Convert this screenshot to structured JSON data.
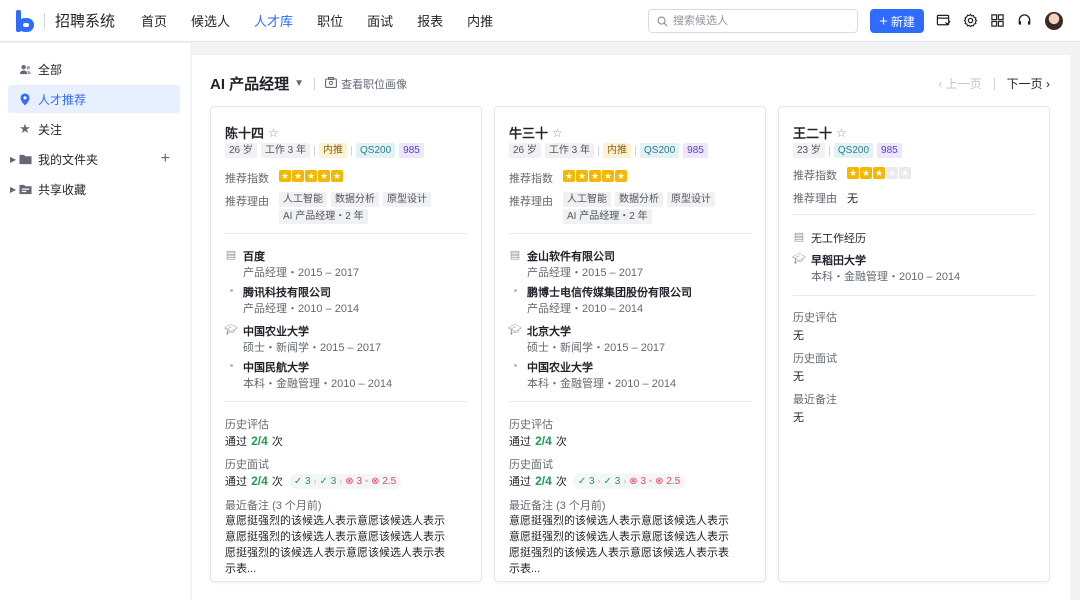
{
  "app": {
    "title": "招聘系统"
  },
  "nav": [
    "首页",
    "候选人",
    "人才库",
    "职位",
    "面试",
    "报表",
    "内推"
  ],
  "nav_active": "人才库",
  "search": {
    "placeholder": "搜索候选人"
  },
  "new_button": "新建",
  "top_icons": [
    "task-icon",
    "gear-icon",
    "apps-grid-icon",
    "headset-icon"
  ],
  "sidebar": {
    "items": [
      {
        "label": "全部",
        "icon": "users-icon"
      },
      {
        "label": "人才推荐",
        "icon": "location-pin-icon"
      },
      {
        "label": "关注",
        "icon": "star-icon"
      },
      {
        "label": "我的文件夹",
        "icon": "folder-icon"
      },
      {
        "label": "共享收藏",
        "icon": "shared-folder-icon"
      }
    ]
  },
  "main": {
    "job_title": "AI 产品经理",
    "portrait_link": "查看职位画像",
    "pager": {
      "prev": "上一页",
      "next": "下一页"
    }
  },
  "labels": {
    "score": "推荐指数",
    "reason": "推荐理由",
    "history_eval": "历史评估",
    "history_interview": "历史面试",
    "recent_note": "最近备注",
    "passed": "通过",
    "times": "次",
    "none": "无",
    "no_work": "无工作经历"
  },
  "colors": {
    "accent": "#2f6bff",
    "star": "#f5b800",
    "pass": "#1e9e55",
    "fail": "#e34d59"
  },
  "candidates": [
    {
      "name": "陈十四",
      "age": "26 岁",
      "work": "工作 3 年",
      "referral": "内推",
      "qs": "QS200",
      "tier": "985",
      "stars": 5,
      "reasons": [
        "人工智能",
        "数据分析",
        "原型设计",
        "AI 产品经理・2 年"
      ],
      "work_exp": [
        {
          "company": "百度",
          "detail": "产品经理・2015 – 2017"
        },
        {
          "company": "腾讯科技有限公司",
          "detail": "产品经理・2010 – 2014"
        }
      ],
      "education": [
        {
          "school": "中国农业大学",
          "detail": "硕士・新闻学・2015 – 2017"
        },
        {
          "school": "中国民航大学",
          "detail": "本科・金融管理・2010 – 2014"
        }
      ],
      "eval_pass": "2/4",
      "interview_pass": "2/4",
      "interview_rounds": [
        {
          "value": "3",
          "result": "pass"
        },
        {
          "value": "3",
          "result": "pass"
        },
        {
          "value": "3",
          "result": "fail"
        },
        {
          "value": "2.5",
          "result": "fail"
        }
      ],
      "note_time": "(3 个月前)",
      "note": "意愿挺强烈的该候选人表示意愿该候选人表示意愿挺强烈的该候选人表示意愿该候选人表示愿挺强烈的该候选人表示意愿该候选人表示表示表..."
    },
    {
      "name": "牛三十",
      "age": "26 岁",
      "work": "工作 3 年",
      "referral": "内推",
      "qs": "QS200",
      "tier": "985",
      "stars": 5,
      "reasons": [
        "人工智能",
        "数据分析",
        "原型设计",
        "AI 产品经理・2 年"
      ],
      "work_exp": [
        {
          "company": "金山软件有限公司",
          "detail": "产品经理・2015 – 2017"
        },
        {
          "company": "鹏博士电信传媒集团股份有限公司",
          "detail": "产品经理・2010 – 2014"
        }
      ],
      "education": [
        {
          "school": "北京大学",
          "detail": "硕士・新闻学・2015 – 2017"
        },
        {
          "school": "中国农业大学",
          "detail": "本科・金融管理・2010 – 2014"
        }
      ],
      "eval_pass": "2/4",
      "interview_pass": "2/4",
      "interview_rounds": [
        {
          "value": "3",
          "result": "pass"
        },
        {
          "value": "3",
          "result": "pass"
        },
        {
          "value": "3",
          "result": "fail"
        },
        {
          "value": "2.5",
          "result": "fail"
        }
      ],
      "note_time": "(3 个月前)",
      "note": "意愿挺强烈的该候选人表示意愿该候选人表示意愿挺强烈的该候选人表示意愿该候选人表示愿挺强烈的该候选人表示意愿该候选人表示表示表..."
    },
    {
      "name": "王二十",
      "age": "23 岁",
      "qs": "QS200",
      "tier": "985",
      "stars": 3,
      "reason_none": "无",
      "school": "早稻田大学",
      "school_detail": "本科・金融管理・2010 – 2014",
      "eval": "无",
      "interview": "无",
      "note": "无"
    }
  ]
}
